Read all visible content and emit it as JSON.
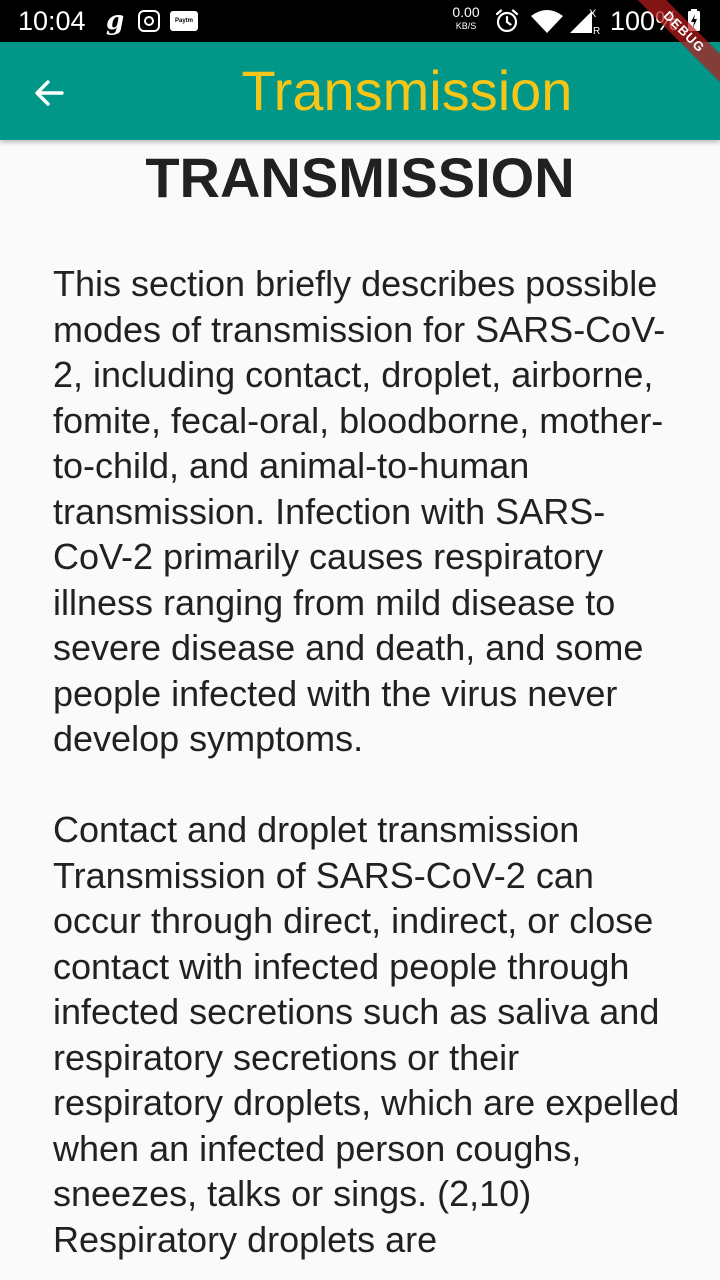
{
  "status_bar": {
    "time": "10:04",
    "notification_icons": [
      "g-icon",
      "instagram-icon",
      "paytm-icon"
    ],
    "paytm_label": "Paytm",
    "network_speed_value": "0.00",
    "network_speed_unit": "KB/S",
    "battery_percent": "100%"
  },
  "app_bar": {
    "title": "Transmission",
    "title_color": "#F5C518",
    "background_color": "#009688",
    "debug_banner": "DEBUG"
  },
  "content": {
    "heading": "TRANSMISSION",
    "body": "This section briefly describes possible modes of transmission for SARS-CoV-2, including contact, droplet, airborne, fomite, fecal-oral, bloodborne, mother-to-child, and animal-to-human transmission. Infection with SARS-CoV-2 primarily causes respiratory illness ranging from mild disease to severe disease and death, and some people infected with the virus never develop symptoms.\n\nContact and droplet transmission Transmission of SARS-CoV-2 can occur through direct, indirect, or close contact with infected people through infected secretions such as saliva and respiratory secretions or their respiratory droplets, which are expelled when an infected person coughs, sneezes, talks or sings. (2,10) Respiratory droplets are"
  }
}
